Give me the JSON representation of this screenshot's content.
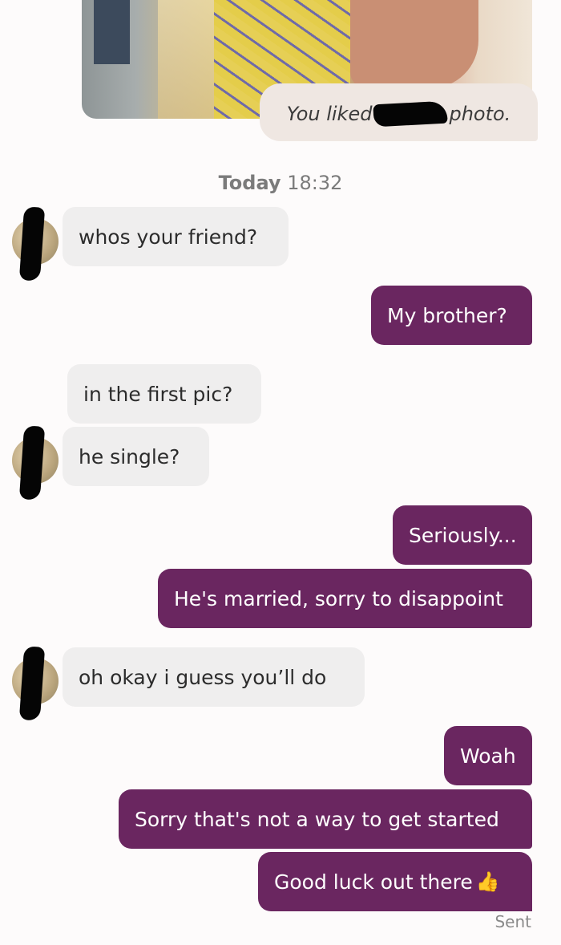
{
  "liked_photo": {
    "prefix": "You liked",
    "suffix": "photo."
  },
  "timestamp": {
    "day": "Today",
    "time": "18:32"
  },
  "messages": [
    {
      "side": "incoming",
      "text": "whos your friend?"
    },
    {
      "side": "outgoing",
      "text": "My brother?"
    },
    {
      "side": "incoming",
      "text": "in the first pic?"
    },
    {
      "side": "incoming",
      "text": "he single?"
    },
    {
      "side": "outgoing",
      "text": "Seriously..."
    },
    {
      "side": "outgoing",
      "text": "He's married, sorry to disappoint"
    },
    {
      "side": "incoming",
      "text": "oh okay i guess you’ll do"
    },
    {
      "side": "outgoing",
      "text": "Woah"
    },
    {
      "side": "outgoing",
      "text": "Sorry that's not a way to get started"
    },
    {
      "side": "outgoing",
      "text": "Good luck out there",
      "emoji": "👍"
    }
  ],
  "status": "Sent",
  "colors": {
    "outgoing_bubble": "#6a2660",
    "incoming_bubble": "#efeeee",
    "background": "#fdfbfb"
  }
}
